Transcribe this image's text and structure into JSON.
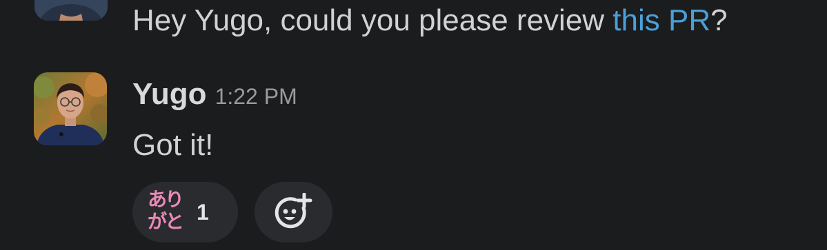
{
  "previous_message": {
    "text_before_link": "Hey Yugo, could you please review ",
    "link_text": "this PR",
    "text_after_link": "?"
  },
  "message": {
    "sender": "Yugo",
    "timestamp": "1:22 PM",
    "body": "Got it!"
  },
  "reactions": [
    {
      "emoji_line1": "あり",
      "emoji_line2": "がと",
      "emoji_icon": "arigato-emoji",
      "count": "1"
    }
  ],
  "add_reaction_icon": "add-reaction-icon",
  "colors": {
    "background": "#1b1c1e",
    "link": "#4a9fd8",
    "reaction_bg": "#2a2b2e",
    "emoji_pink": "#e98ab7"
  }
}
